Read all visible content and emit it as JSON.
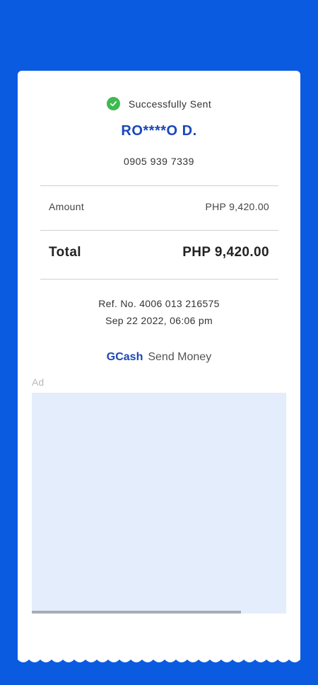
{
  "status": {
    "icon": "check-circle-icon",
    "text": "Successfully Sent",
    "color": "#3fb950"
  },
  "recipient": {
    "name": "RO****O D.",
    "number": "0905 939 7339"
  },
  "amount": {
    "label": "Amount",
    "value": "PHP 9,420.00"
  },
  "total": {
    "label": "Total",
    "value": "PHP 9,420.00"
  },
  "reference": {
    "text": "Ref. No. 4006 013 216575",
    "datetime": "Sep 22 2022, 06:06 pm"
  },
  "brand": {
    "logo": "GCash",
    "service": "Send Money",
    "color": "#1a47b8"
  },
  "ad": {
    "label": "Ad"
  },
  "colors": {
    "background": "#0a5be0",
    "accent": "#1a47b8"
  }
}
